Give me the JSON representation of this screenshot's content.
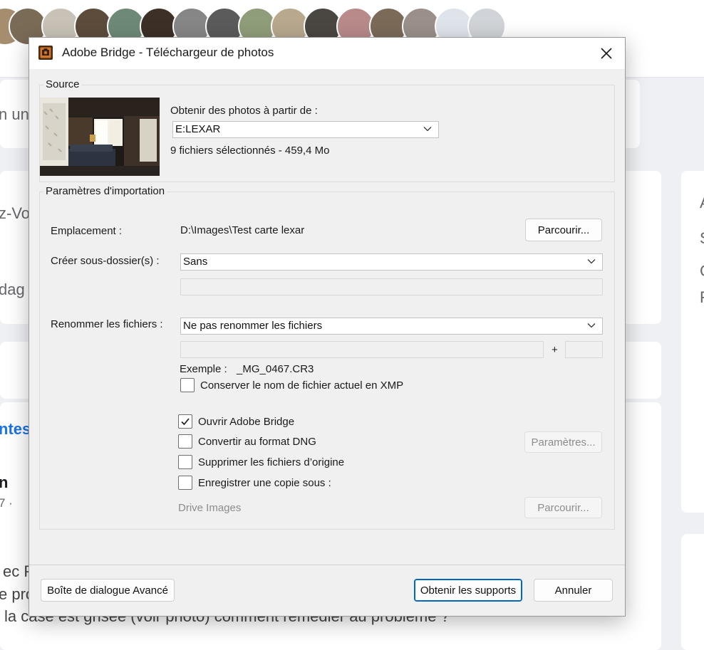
{
  "dialog": {
    "title": "Adobe Bridge - Téléchargeur de photos",
    "source": {
      "legend": "Source",
      "get_photos_label": "Obtenir des photos à partir de :",
      "device_value": "E:LEXAR",
      "selection_info": "9 fichiers sélectionnés - 459,4 Mo"
    },
    "import": {
      "legend": "Paramètres d'importation",
      "location_label": "Emplacement :",
      "location_value": "D:\\Images\\Test carte lexar",
      "browse_label": "Parcourir...",
      "subfolder_label": "Créer sous-dossier(s) :",
      "subfolder_value": "Sans",
      "rename_label": "Renommer les fichiers :",
      "rename_value": "Ne pas renommer les fichiers",
      "plus": "+",
      "example_label": "Exemple :",
      "example_value": "_MG_0467.CR3",
      "keep_name_xmp": "Conserver le nom de fichier actuel en XMP",
      "open_bridge": "Ouvrir Adobe Bridge",
      "convert_dng": "Convertir au format DNG",
      "dng_settings": "Paramètres...",
      "delete_originals": "Supprimer les fichiers d’origine",
      "save_copy": "Enregistrer une copie sous :",
      "copy_dest": "Drive Images",
      "copy_browse": "Parcourir..."
    },
    "checkboxes": {
      "keep_name_xmp": false,
      "open_bridge": true,
      "convert_dng": false,
      "delete_originals": false,
      "save_copy": false
    },
    "footer": {
      "advanced": "Boîte de dialogue Avancé",
      "get_media": "Obtenir les supports",
      "cancel": "Annuler"
    }
  },
  "background": {
    "snippets": [
      "n une",
      "z-Vo",
      "dag",
      "ntes",
      "n",
      "7 ·",
      "ec P",
      "e pro",
      "la case est grisée (voir photo) comment remédier au problème ? ",
      "A",
      "S",
      "C",
      "F"
    ]
  },
  "colors": {
    "accent": "#0067c0",
    "dialog_bg": "#f0f0f0",
    "page_bg": "#eef0f3"
  },
  "icons": {
    "app": "adobe-bridge-icon",
    "close": "close-icon",
    "dropdown": "chevron-down-icon",
    "check": "checkmark-icon"
  }
}
